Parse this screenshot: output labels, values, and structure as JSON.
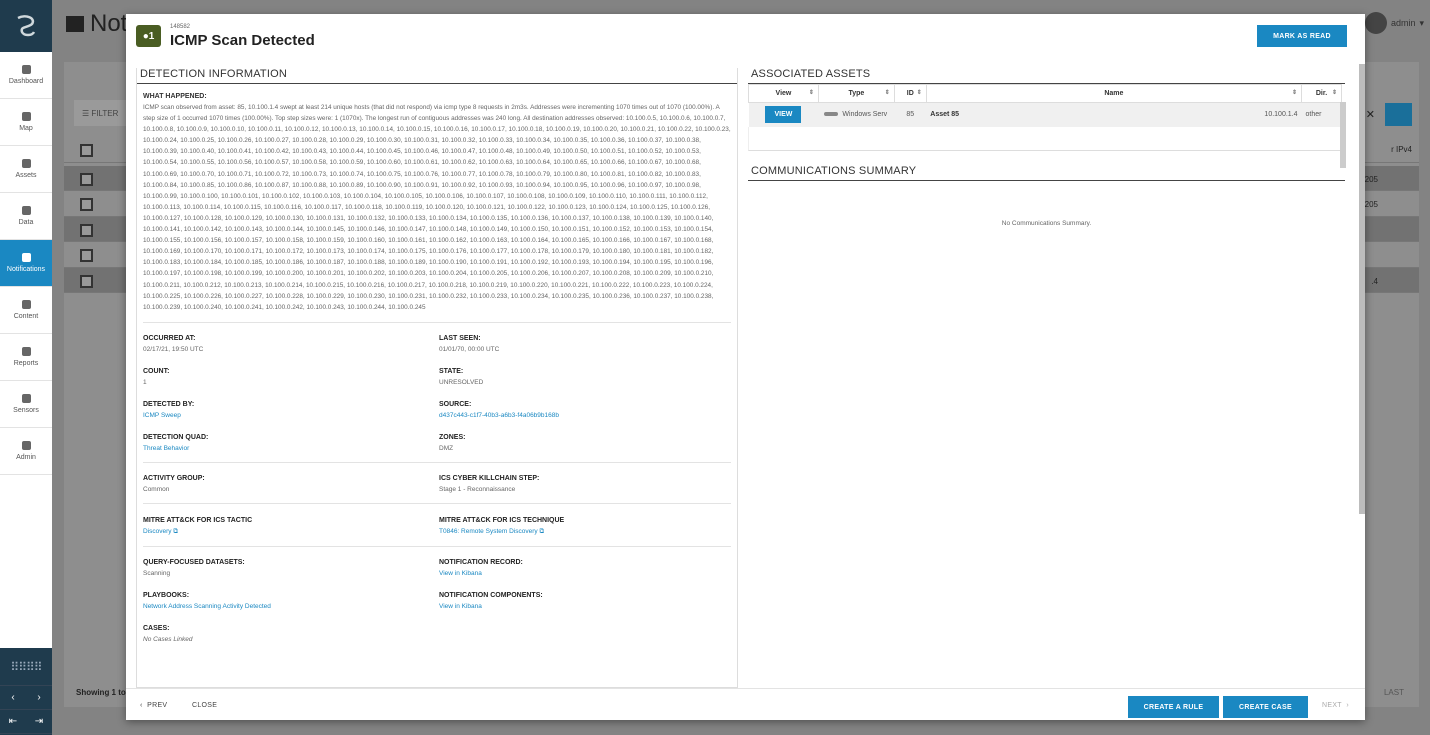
{
  "sidebar": {
    "items": [
      {
        "label": "Dashboard"
      },
      {
        "label": "Map"
      },
      {
        "label": "Assets"
      },
      {
        "label": "Data"
      },
      {
        "label": "Notifications"
      },
      {
        "label": "Content"
      },
      {
        "label": "Reports"
      },
      {
        "label": "Sensors"
      },
      {
        "label": "Admin"
      }
    ],
    "active": "Notifications",
    "accent": "#1a88c2",
    "dark": "#1f3b4d"
  },
  "background": {
    "page_title": "Not",
    "user": "admin",
    "filter_label": "FILTER",
    "column_ipv4": "r IPv4",
    "ips": [
      ".205",
      ".205",
      "",
      "",
      ".4"
    ],
    "showing": "Showing 1 to",
    "last": "LAST"
  },
  "modal": {
    "badge": "1",
    "id": "148582",
    "title": "ICMP Scan Detected",
    "mark_read": "MARK AS READ",
    "detection_info": {
      "heading": "DETECTION INFORMATION",
      "what_label": "WHAT HAPPENED:",
      "what_text": "ICMP scan observed from asset: 85, 10.100.1.4 swept at least 214 unique hosts (that did not respond) via icmp type 8 requests in 2m3s. Addresses were incrementing 1070 times out of 1070 (100.00%). A step size of 1 occurred 1070 times (100.00%). Top step sizes were: 1 (1070x). The longest run of contiguous addresses was 240 long. All destination addresses observed: 10.100.0.5, 10.100.0.6, 10.100.0.7, 10.100.0.8, 10.100.0.9, 10.100.0.10, 10.100.0.11, 10.100.0.12, 10.100.0.13, 10.100.0.14, 10.100.0.15, 10.100.0.16, 10.100.0.17, 10.100.0.18, 10.100.0.19, 10.100.0.20, 10.100.0.21, 10.100.0.22, 10.100.0.23, 10.100.0.24, 10.100.0.25, 10.100.0.26, 10.100.0.27, 10.100.0.28, 10.100.0.29, 10.100.0.30, 10.100.0.31, 10.100.0.32, 10.100.0.33, 10.100.0.34, 10.100.0.35, 10.100.0.36, 10.100.0.37, 10.100.0.38, 10.100.0.39, 10.100.0.40, 10.100.0.41, 10.100.0.42, 10.100.0.43, 10.100.0.44, 10.100.0.45, 10.100.0.46, 10.100.0.47, 10.100.0.48, 10.100.0.49, 10.100.0.50, 10.100.0.51, 10.100.0.52, 10.100.0.53, 10.100.0.54, 10.100.0.55, 10.100.0.56, 10.100.0.57, 10.100.0.58, 10.100.0.59, 10.100.0.60, 10.100.0.61, 10.100.0.62, 10.100.0.63, 10.100.0.64, 10.100.0.65, 10.100.0.66, 10.100.0.67, 10.100.0.68, 10.100.0.69, 10.100.0.70, 10.100.0.71, 10.100.0.72, 10.100.0.73, 10.100.0.74, 10.100.0.75, 10.100.0.76, 10.100.0.77, 10.100.0.78, 10.100.0.79, 10.100.0.80, 10.100.0.81, 10.100.0.82, 10.100.0.83, 10.100.0.84, 10.100.0.85, 10.100.0.86, 10.100.0.87, 10.100.0.88, 10.100.0.89, 10.100.0.90, 10.100.0.91, 10.100.0.92, 10.100.0.93, 10.100.0.94, 10.100.0.95, 10.100.0.96, 10.100.0.97, 10.100.0.98, 10.100.0.99, 10.100.0.100, 10.100.0.101, 10.100.0.102, 10.100.0.103, 10.100.0.104, 10.100.0.105, 10.100.0.106, 10.100.0.107, 10.100.0.108, 10.100.0.109, 10.100.0.110, 10.100.0.111, 10.100.0.112, 10.100.0.113, 10.100.0.114, 10.100.0.115, 10.100.0.116, 10.100.0.117, 10.100.0.118, 10.100.0.119, 10.100.0.120, 10.100.0.121, 10.100.0.122, 10.100.0.123, 10.100.0.124, 10.100.0.125, 10.100.0.126, 10.100.0.127, 10.100.0.128, 10.100.0.129, 10.100.0.130, 10.100.0.131, 10.100.0.132, 10.100.0.133, 10.100.0.134, 10.100.0.135, 10.100.0.136, 10.100.0.137, 10.100.0.138, 10.100.0.139, 10.100.0.140, 10.100.0.141, 10.100.0.142, 10.100.0.143, 10.100.0.144, 10.100.0.145, 10.100.0.146, 10.100.0.147, 10.100.0.148, 10.100.0.149, 10.100.0.150, 10.100.0.151, 10.100.0.152, 10.100.0.153, 10.100.0.154, 10.100.0.155, 10.100.0.156, 10.100.0.157, 10.100.0.158, 10.100.0.159, 10.100.0.160, 10.100.0.161, 10.100.0.162, 10.100.0.163, 10.100.0.164, 10.100.0.165, 10.100.0.166, 10.100.0.167, 10.100.0.168, 10.100.0.169, 10.100.0.170, 10.100.0.171, 10.100.0.172, 10.100.0.173, 10.100.0.174, 10.100.0.175, 10.100.0.176, 10.100.0.177, 10.100.0.178, 10.100.0.179, 10.100.0.180, 10.100.0.181, 10.100.0.182, 10.100.0.183, 10.100.0.184, 10.100.0.185, 10.100.0.186, 10.100.0.187, 10.100.0.188, 10.100.0.189, 10.100.0.190, 10.100.0.191, 10.100.0.192, 10.100.0.193, 10.100.0.194, 10.100.0.195, 10.100.0.196, 10.100.0.197, 10.100.0.198, 10.100.0.199, 10.100.0.200, 10.100.0.201, 10.100.0.202, 10.100.0.203, 10.100.0.204, 10.100.0.205, 10.100.0.206, 10.100.0.207, 10.100.0.208, 10.100.0.209, 10.100.0.210, 10.100.0.211, 10.100.0.212, 10.100.0.213, 10.100.0.214, 10.100.0.215, 10.100.0.216, 10.100.0.217, 10.100.0.218, 10.100.0.219, 10.100.0.220, 10.100.0.221, 10.100.0.222, 10.100.0.223, 10.100.0.224, 10.100.0.225, 10.100.0.226, 10.100.0.227, 10.100.0.228, 10.100.0.229, 10.100.0.230, 10.100.0.231, 10.100.0.232, 10.100.0.233, 10.100.0.234, 10.100.0.235, 10.100.0.236, 10.100.0.237, 10.100.0.238, 10.100.0.239, 10.100.0.240, 10.100.0.241, 10.100.0.242, 10.100.0.243, 10.100.0.244, 10.100.0.245",
      "fields": {
        "occurred_at": {
          "label": "OCCURRED AT:",
          "value": "02/17/21, 19:50 UTC"
        },
        "last_seen": {
          "label": "LAST SEEN:",
          "value": "01/01/70, 00:00 UTC"
        },
        "count": {
          "label": "COUNT:",
          "value": "1"
        },
        "state": {
          "label": "STATE:",
          "value": "UNRESOLVED"
        },
        "detected_by": {
          "label": "DETECTED BY:",
          "value": "ICMP Sweep"
        },
        "source": {
          "label": "SOURCE:",
          "value": "d437c443-c1f7-40b3-a6b3-f4a06b9b168b"
        },
        "detection_quad": {
          "label": "DETECTION QUAD:",
          "value": "Threat Behavior"
        },
        "zones": {
          "label": "ZONES:",
          "value": "DMZ"
        },
        "activity_group": {
          "label": "ACTIVITY GROUP:",
          "value": "Common"
        },
        "killchain": {
          "label": "ICS CYBER KILLCHAIN STEP:",
          "value": "Stage 1 - Reconnaissance"
        },
        "tactic": {
          "label": "MITRE ATT&CK FOR ICS TACTIC",
          "value": "Discovery"
        },
        "technique": {
          "label": "MITRE ATT&CK FOR ICS TECHNIQUE",
          "value": "T0846: Remote System Discovery"
        },
        "datasets": {
          "label": "QUERY-FOCUSED DATASETS:",
          "value": "Scanning"
        },
        "record": {
          "label": "NOTIFICATION RECORD:",
          "value": "View in Kibana"
        },
        "playbooks": {
          "label": "PLAYBOOKS:",
          "value": "Network Address Scanning Activity Detected"
        },
        "components": {
          "label": "NOTIFICATION COMPONENTS:",
          "value": "View in Kibana"
        },
        "cases": {
          "label": "CASES:",
          "value": "No Cases Linked"
        }
      }
    },
    "assets": {
      "heading": "ASSOCIATED ASSETS",
      "columns": [
        "View",
        "Type",
        "ID",
        "Name",
        "Dir."
      ],
      "row": {
        "view": "VIEW",
        "type": "Windows Serv",
        "id": "85",
        "name": "Asset 85",
        "ip": "10.100.1.4",
        "dir": "other"
      }
    },
    "comms": {
      "heading": "COMMUNICATIONS SUMMARY",
      "empty": "No Communications Summary."
    },
    "footer": {
      "prev": "PREV",
      "close": "CLOSE",
      "create_rule": "CREATE A RULE",
      "create_case": "CREATE CASE",
      "next": "NEXT"
    }
  }
}
